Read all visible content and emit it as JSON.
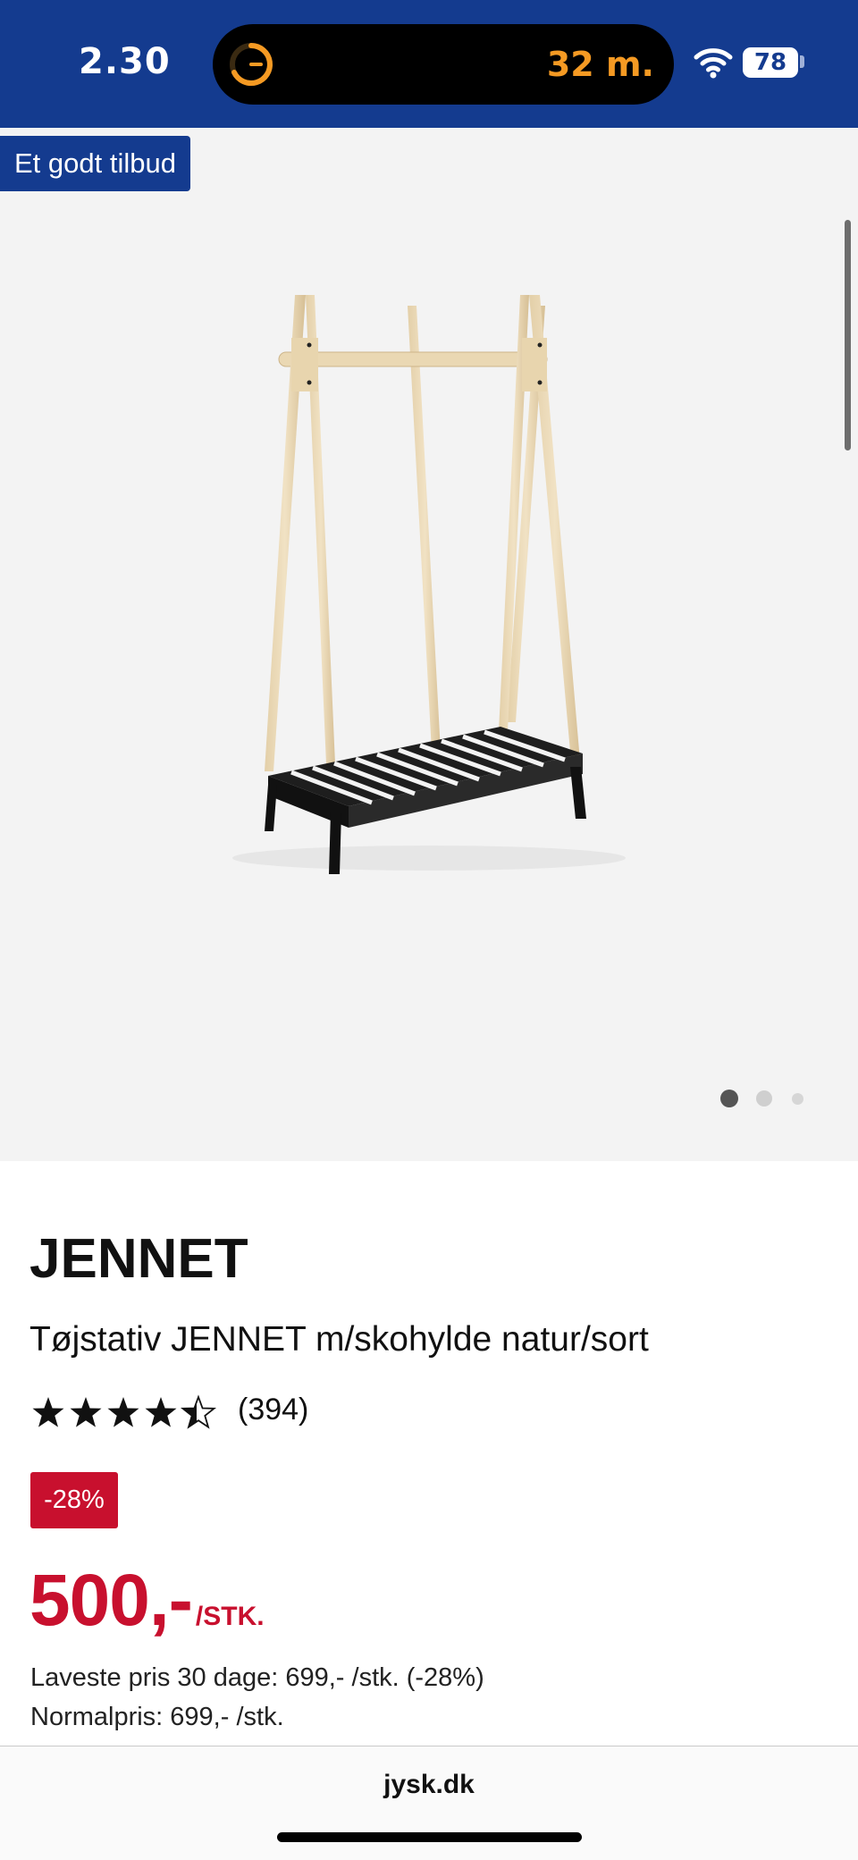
{
  "status_bar": {
    "time": "2.30",
    "eta": "32 m.",
    "battery": "78"
  },
  "gallery": {
    "offer_badge": "Et godt tilbud",
    "slide_count": 3,
    "active_slide": 1
  },
  "product": {
    "brand": "JENNET",
    "title": "Tøjstativ JENNET m/skohylde natur/sort",
    "rating": 4.5,
    "review_count": "(394)",
    "discount_badge": "-28%",
    "price": "500,-",
    "price_unit": "/STK.",
    "lowest_price": "Laveste pris 30 dage: 699,- /stk. (-28%)",
    "normal_price": "Normalpris: 699,- /stk."
  },
  "browser": {
    "url": "jysk.dk"
  },
  "colors": {
    "brand_blue": "#143b8f",
    "sale_red": "#c8102e",
    "eta_orange": "#f59a23"
  }
}
